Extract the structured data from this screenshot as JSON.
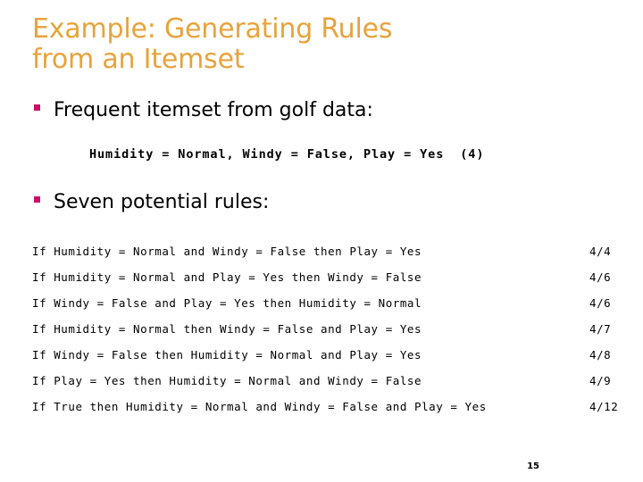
{
  "slide": {
    "title": "Example: Generating Rules\nfrom an Itemset",
    "title_color": "#E8A33A",
    "bullet_color": "#CE0F69",
    "background_color": "#FFFFFF",
    "page_number": "15"
  },
  "sections": {
    "itemset_heading": "Frequent itemset from golf data:",
    "itemset_line": "Humidity = Normal, Windy = False, Play = Yes  (4)",
    "rules_heading": "Seven potential rules:"
  },
  "rules": [
    {
      "text": "If Humidity = Normal and Windy = False then Play = Yes",
      "value": "4/4"
    },
    {
      "text": "If Humidity = Normal and Play = Yes then Windy = False",
      "value": "4/6"
    },
    {
      "text": "If Windy = False and Play = Yes then Humidity = Normal",
      "value": "4/6"
    },
    {
      "text": "If Humidity = Normal then Windy = False and Play = Yes",
      "value": "4/7"
    },
    {
      "text": "If Windy = False then Humidity = Normal and Play = Yes",
      "value": "4/8"
    },
    {
      "text": "If Play = Yes then Humidity = Normal and Windy = False",
      "value": "4/9"
    },
    {
      "text": "If True then Humidity = Normal and Windy = False and Play = Yes",
      "value": "4/12"
    }
  ]
}
